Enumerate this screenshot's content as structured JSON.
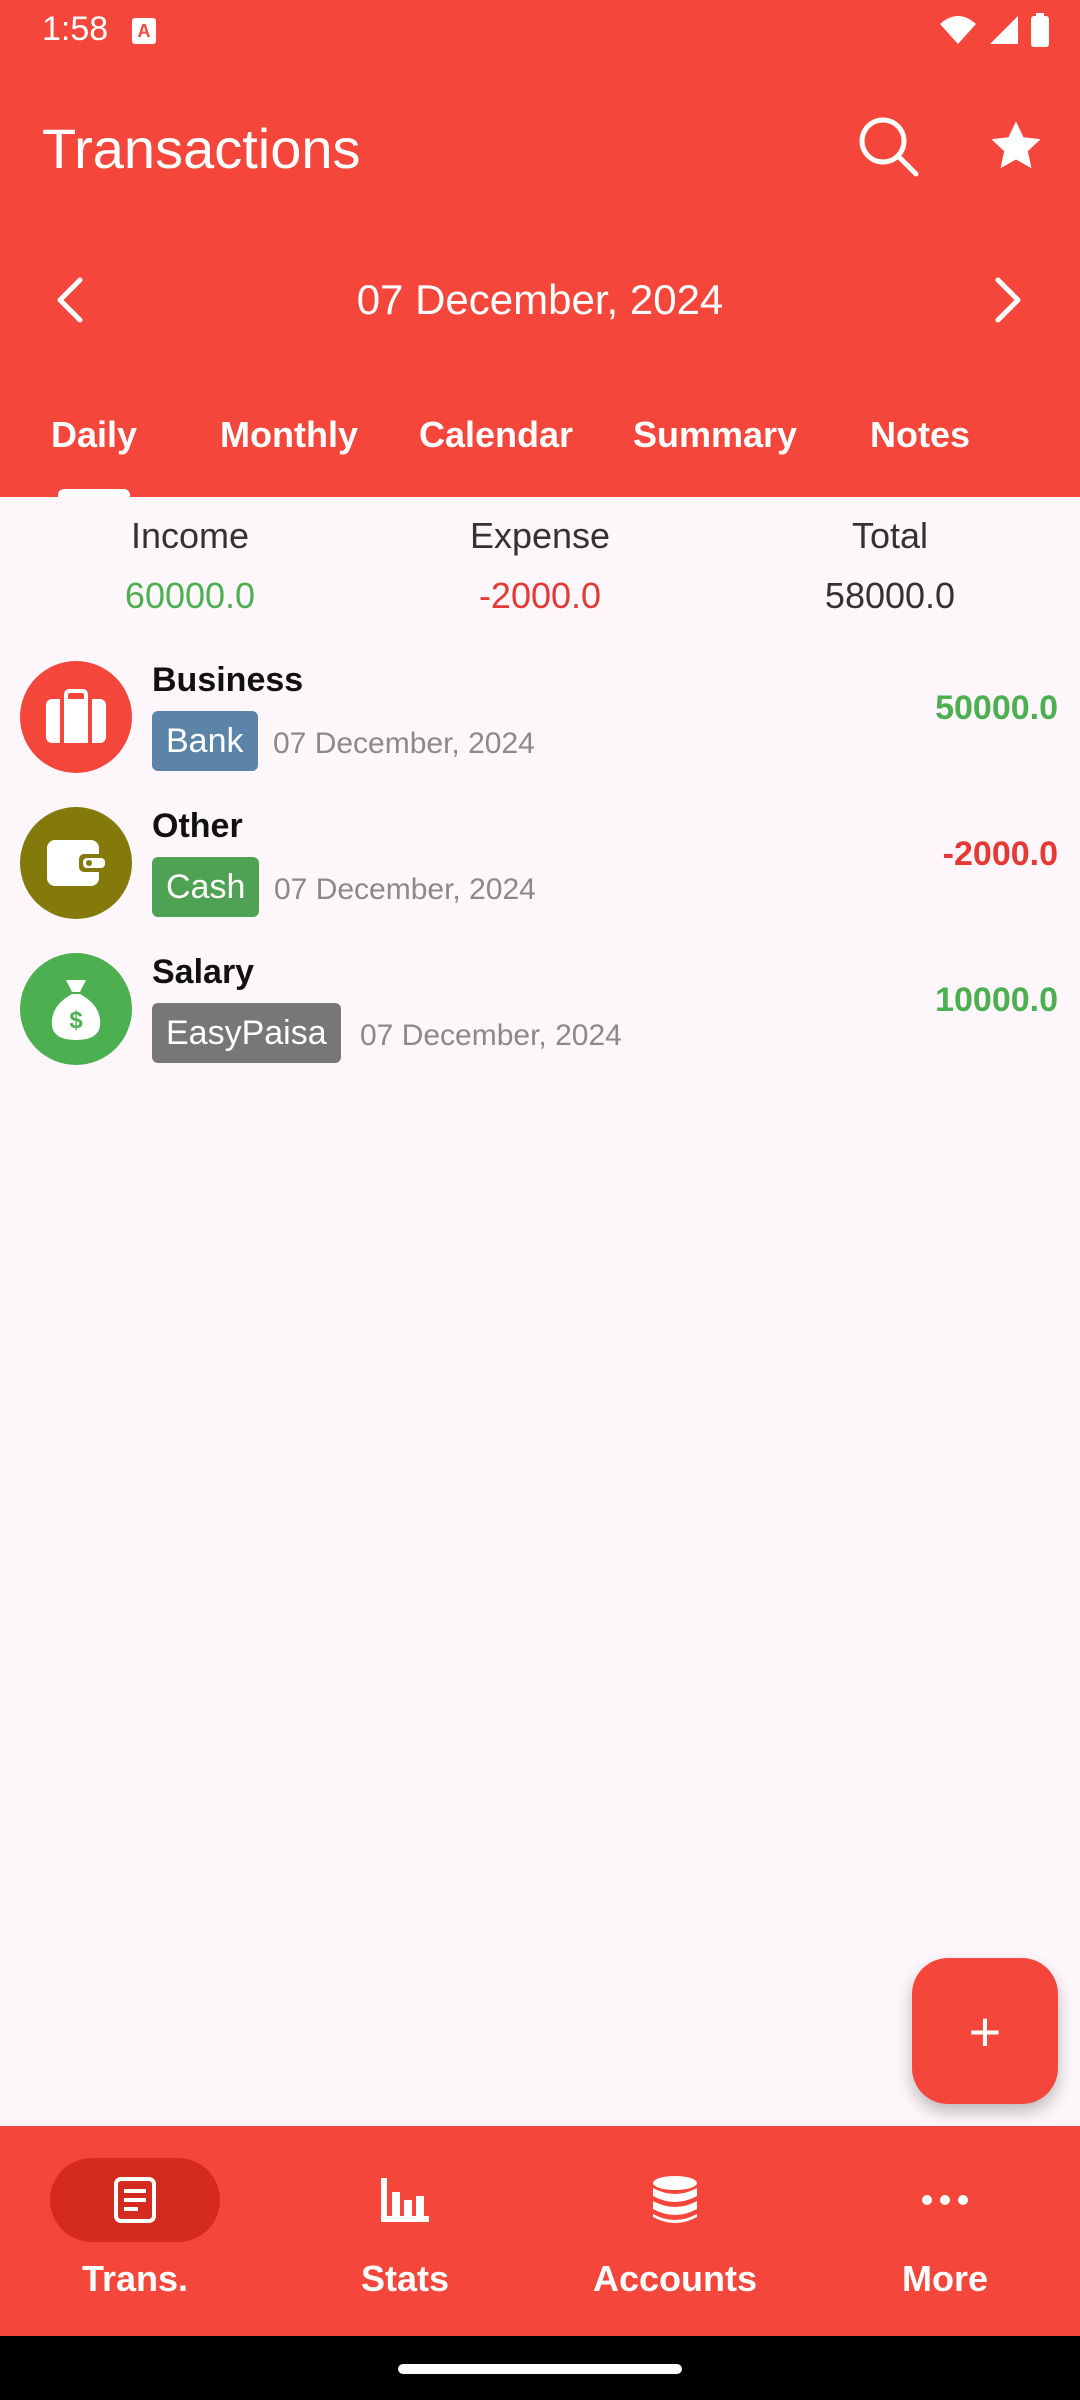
{
  "status_bar": {
    "time": "1:58",
    "notif_letter": "A"
  },
  "app_bar": {
    "title": "Transactions"
  },
  "date_nav": {
    "date": "07 December, 2024"
  },
  "tabs": [
    {
      "label": "Daily"
    },
    {
      "label": "Monthly"
    },
    {
      "label": "Calendar"
    },
    {
      "label": "Summary"
    },
    {
      "label": "Notes"
    }
  ],
  "summary": {
    "income_label": "Income",
    "income_value": "60000.0",
    "expense_label": "Expense",
    "expense_value": "-2000.0",
    "total_label": "Total",
    "total_value": "58000.0"
  },
  "transactions": [
    {
      "category": "Business",
      "account": "Bank",
      "date": "07 December, 2024",
      "amount": "50000.0",
      "icon": "briefcase-icon"
    },
    {
      "category": "Other",
      "account": "Cash",
      "date": "07 December, 2024",
      "amount": "-2000.0",
      "icon": "wallet-icon"
    },
    {
      "category": "Salary",
      "account": "EasyPaisa",
      "date": "07 December, 2024",
      "amount": "10000.0",
      "icon": "money-bag-icon"
    }
  ],
  "fab": {
    "label": "+"
  },
  "bottom_nav": [
    {
      "label": "Trans.",
      "icon": "document-icon"
    },
    {
      "label": "Stats",
      "icon": "bar-chart-icon"
    },
    {
      "label": "Accounts",
      "icon": "database-icon"
    },
    {
      "label": "More",
      "icon": "more-dots-icon"
    }
  ],
  "colors": {
    "primary": "#f5463b",
    "income": "#4caf50",
    "expense": "#e53935",
    "chip_bank": "#5b84a8",
    "chip_cash": "#4fa153",
    "chip_easypaisa": "#777777",
    "avatar_business": "#f5463b",
    "avatar_other": "#847a0c",
    "avatar_salary": "#4caf50"
  }
}
